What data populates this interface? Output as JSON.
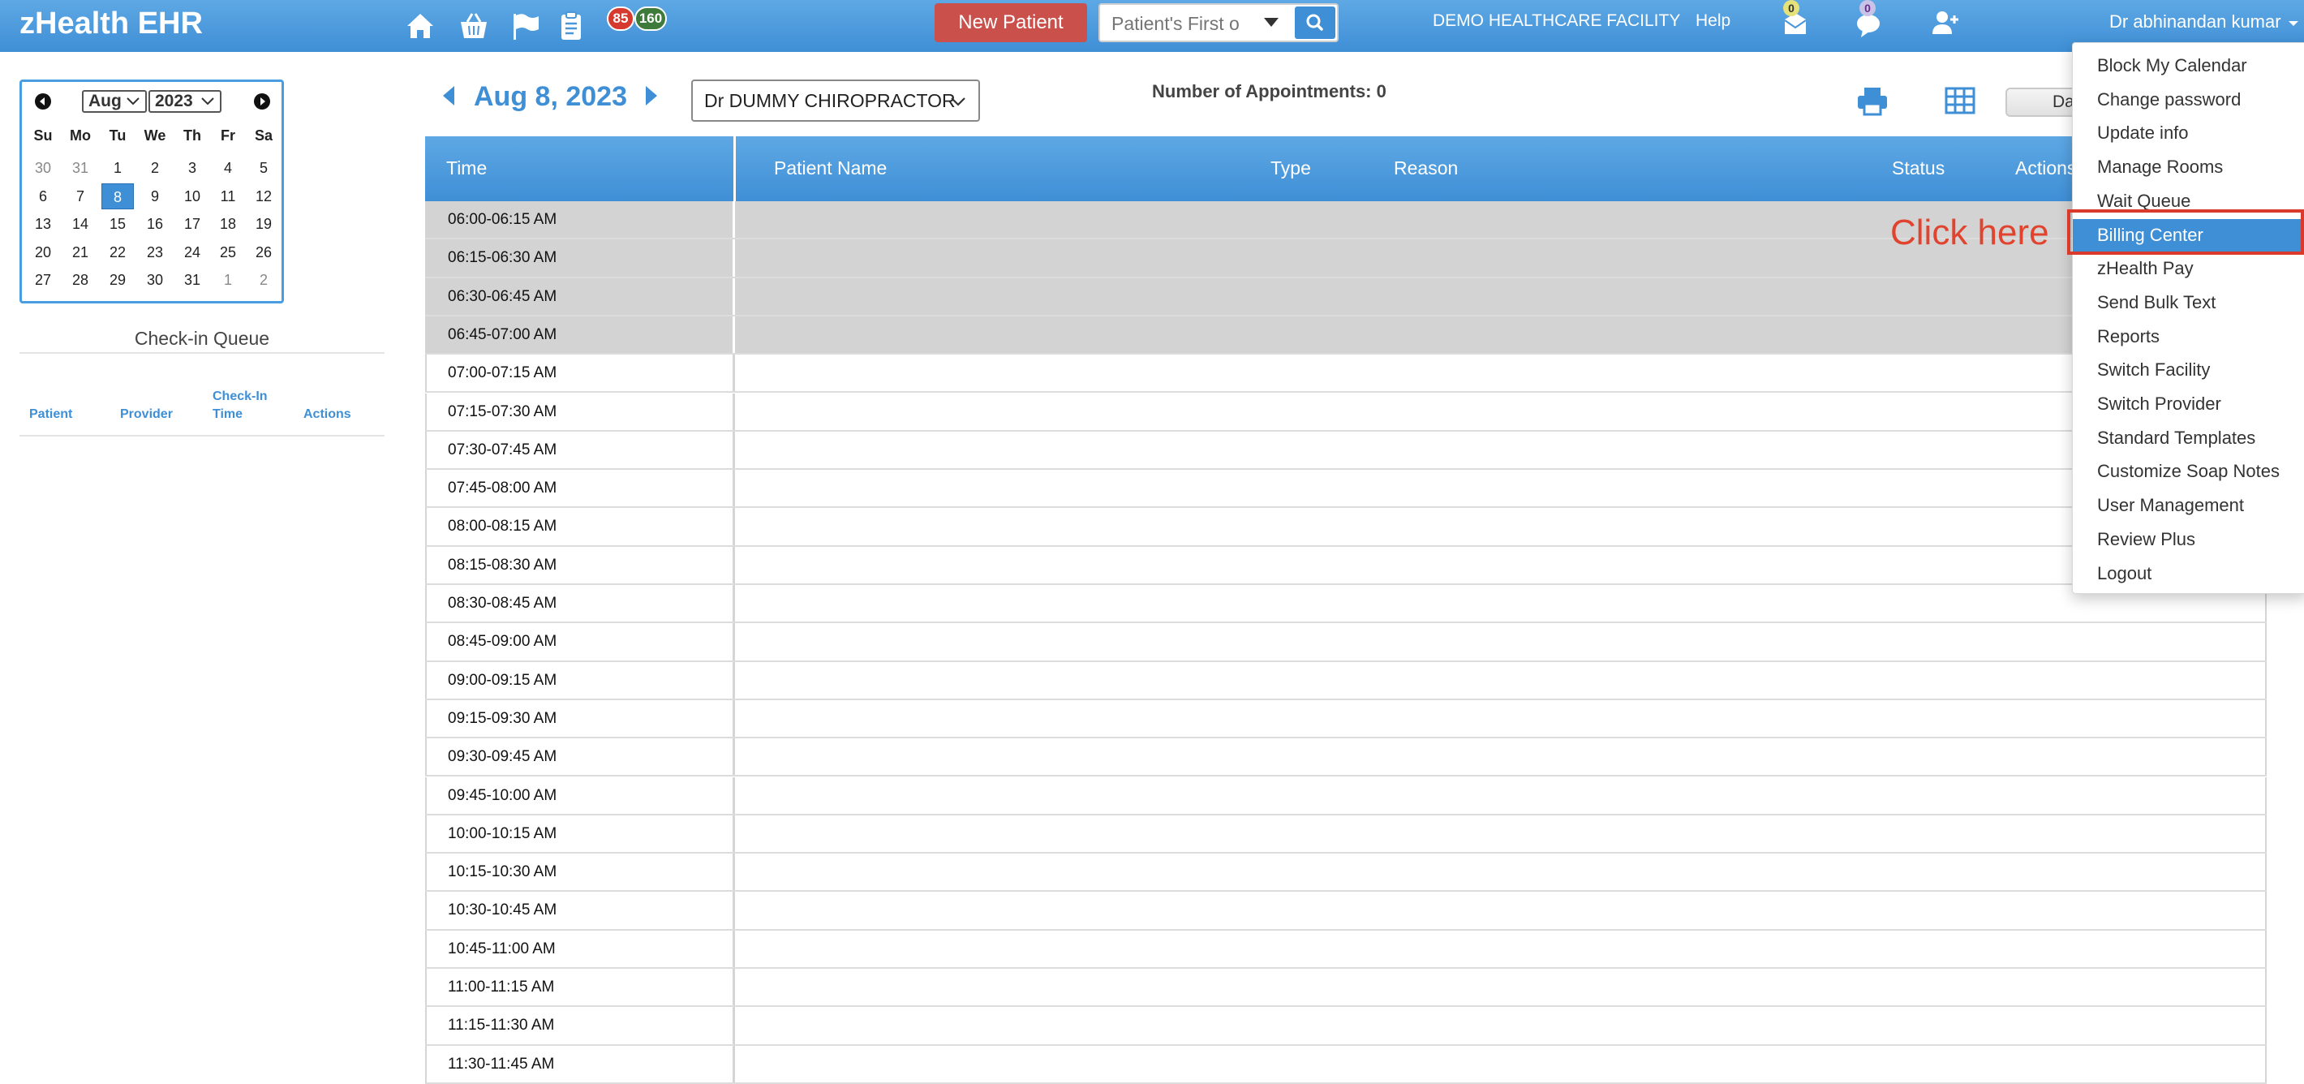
{
  "app": {
    "title": "zHealth EHR"
  },
  "header": {
    "badges": [
      "85",
      "160"
    ],
    "new_patient_label": "New Patient",
    "search": {
      "placeholder": "Patient's First o",
      "value": ""
    },
    "facility": "DEMO HEALTHCARE FACILITY",
    "help": "Help",
    "mail_count": "0",
    "chat_count": "0",
    "user": "Dr abhinandan kumar"
  },
  "mini_calendar": {
    "month": "Aug",
    "year": "2023",
    "weekdays": [
      "Su",
      "Mo",
      "Tu",
      "We",
      "Th",
      "Fr",
      "Sa"
    ],
    "weeks": [
      [
        "30",
        "31",
        "1",
        "2",
        "3",
        "4",
        "5"
      ],
      [
        "6",
        "7",
        "8",
        "9",
        "10",
        "11",
        "12"
      ],
      [
        "13",
        "14",
        "15",
        "16",
        "17",
        "18",
        "19"
      ],
      [
        "20",
        "21",
        "22",
        "23",
        "24",
        "25",
        "26"
      ],
      [
        "27",
        "28",
        "29",
        "30",
        "31",
        "1",
        "2"
      ]
    ],
    "selected_day": "8"
  },
  "checkin_queue": {
    "title": "Check-in Queue",
    "columns": [
      "Patient",
      "Provider",
      "Check-In",
      "Time",
      "Actions"
    ]
  },
  "schedule": {
    "date": "Aug 8, 2023",
    "provider": "Dr DUMMY CHIROPRACTOR",
    "appointment_count": "Number of Appointments: 0",
    "view_label": "Day",
    "columns": [
      "Time",
      "Patient Name",
      "Type",
      "Reason",
      "Status",
      "Actions"
    ],
    "slots": [
      "06:00-06:15 AM",
      "06:15-06:30 AM",
      "06:30-06:45 AM",
      "06:45-07:00 AM",
      "07:00-07:15 AM",
      "07:15-07:30 AM",
      "07:30-07:45 AM",
      "07:45-08:00 AM",
      "08:00-08:15 AM",
      "08:15-08:30 AM",
      "08:30-08:45 AM",
      "08:45-09:00 AM",
      "09:00-09:15 AM",
      "09:15-09:30 AM",
      "09:30-09:45 AM",
      "09:45-10:00 AM",
      "10:00-10:15 AM",
      "10:15-10:30 AM",
      "10:30-10:45 AM",
      "10:45-11:00 AM",
      "11:00-11:15 AM",
      "11:15-11:30 AM",
      "11:30-11:45 AM"
    ],
    "blocked_slot_count": 4
  },
  "user_menu": {
    "items": [
      "Block My Calendar",
      "Change password",
      "Update info",
      "Manage Rooms",
      "Wait Queue",
      "Billing Center",
      "zHealth Pay",
      "Send Bulk Text",
      "Reports",
      "Switch Facility",
      "Switch Provider",
      "Standard Templates",
      "Customize Soap Notes",
      "User Management",
      "Review Plus",
      "Logout"
    ],
    "active_item": "Billing Center"
  },
  "annotation": {
    "text": "Click here",
    "color": "#e0442f"
  },
  "colors": {
    "primary": "#3f8fd6",
    "danger_button": "#c9504b",
    "blocked_row": "#d3d3d3"
  }
}
